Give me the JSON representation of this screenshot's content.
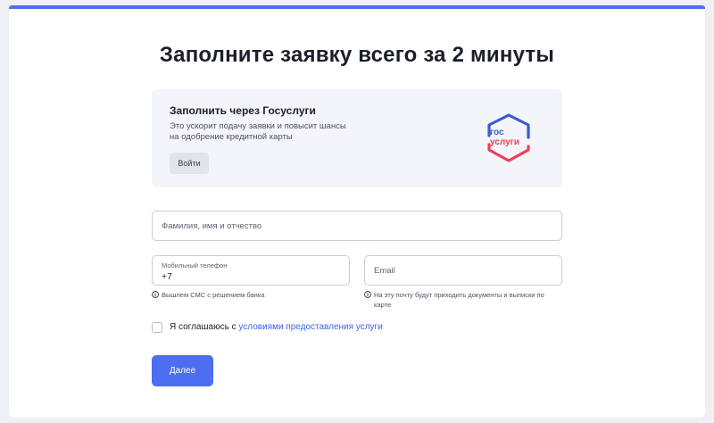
{
  "form": {
    "title": "Заполните заявку всего за 2 минуты"
  },
  "gosuslugi": {
    "title": "Заполнить через Госуслуги",
    "description": "Это ускорит подачу заявки и повысит шансы на одобрение кредитной карты",
    "login_button": "Войти",
    "logo_text_top": "гос",
    "logo_text_bottom": "услуги",
    "logo_colors": {
      "blue": "#3b5bd6",
      "red": "#ee3f58"
    }
  },
  "fields": {
    "fio": {
      "placeholder": "Фамилия, имя и отчество",
      "value": ""
    },
    "phone": {
      "label": "Мобильный телефон",
      "value": "+7",
      "hint": "Вышлем СМС с решением банка",
      "hint_icon": "info-icon"
    },
    "email": {
      "placeholder": "Email",
      "value": "",
      "hint": "На эту почту будут приходить документы и выписки по карте",
      "hint_icon": "info-icon"
    }
  },
  "consent": {
    "checked": false,
    "text": "Я соглашаюсь с ",
    "link_text": "условиями предоставления услуги"
  },
  "submit": {
    "label": "Далее"
  },
  "colors": {
    "accent": "#4d6ef0",
    "link": "#3d63e8",
    "panel": "#f3f5fb",
    "page_background": "#eef0f4"
  }
}
